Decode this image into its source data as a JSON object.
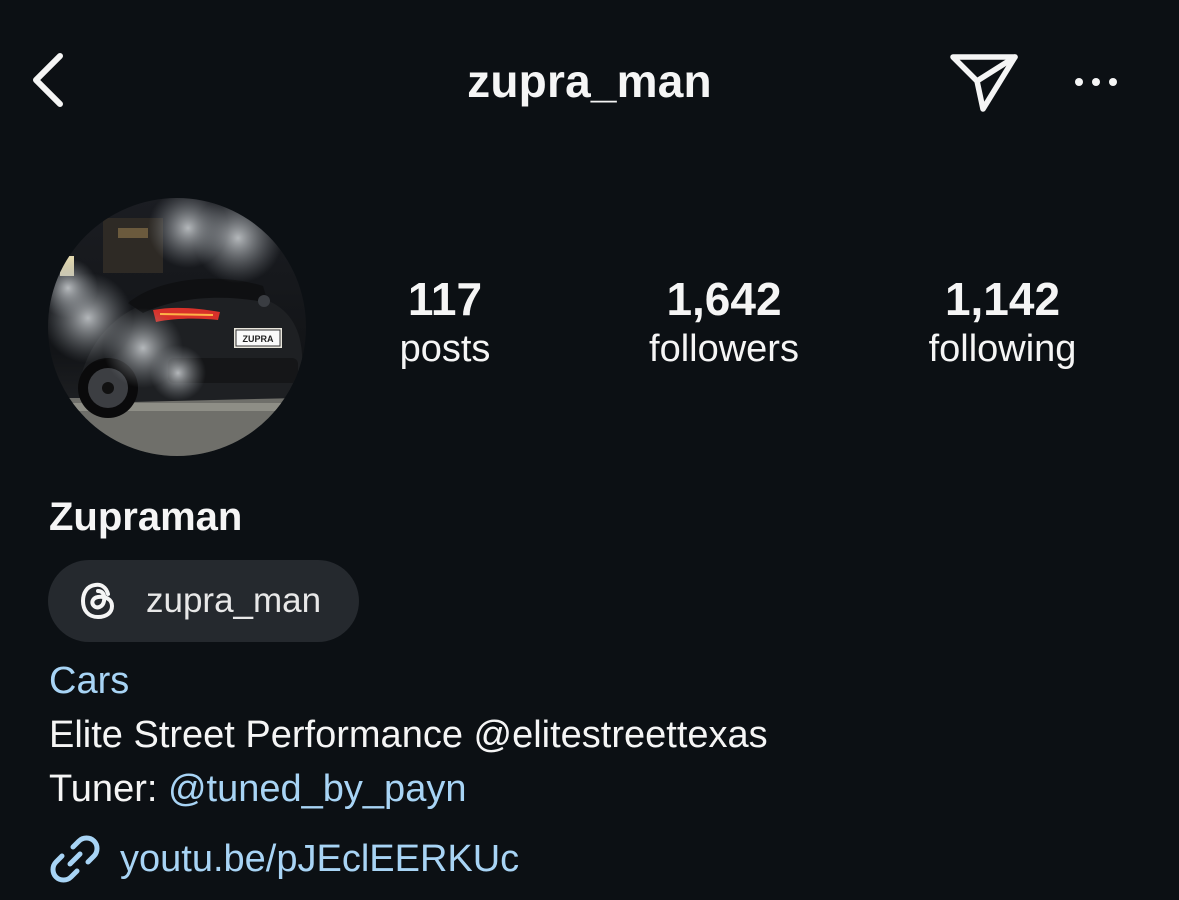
{
  "header": {
    "username": "zupra_man",
    "back_icon": "chevron-left-icon",
    "send_icon": "paper-plane-icon",
    "more_icon": "more-horizontal-icon"
  },
  "profile": {
    "avatar_description_icon": "avatar-photo",
    "stats": [
      {
        "count": "117",
        "label": "posts"
      },
      {
        "count": "1,642",
        "label": "followers"
      },
      {
        "count": "1,142",
        "label": "following"
      }
    ],
    "display_name": "Zupraman",
    "threads": {
      "icon": "threads-icon",
      "handle": "zupra_man"
    },
    "category": "Cars",
    "bio": {
      "line1": "Elite Street Performance @elitestreettexas",
      "line2_prefix": "Tuner: ",
      "line2_mention": "@tuned_by_payn"
    },
    "link": {
      "icon": "link-icon",
      "text": "youtu.be/pJEclEERKUc"
    }
  },
  "colors": {
    "background": "#0c1014",
    "text": "#f5f5f5",
    "link": "#a8d4f5",
    "chip": "#25292e"
  }
}
